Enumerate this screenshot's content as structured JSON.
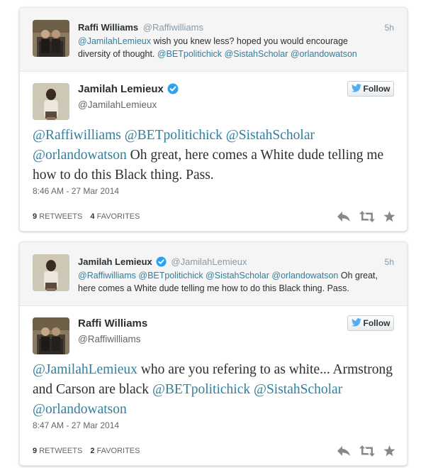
{
  "tweets": [
    {
      "parent": {
        "name": "Raffi Williams",
        "handle": "@Raffiwilliams",
        "time": "5h",
        "text_parts": [
          {
            "t": "@JamilahLemieux",
            "m": true
          },
          {
            "t": " wish you knew less? hoped you would encourage diversity of thought. ",
            "m": false
          },
          {
            "t": "@BETpolitichick",
            "m": true
          },
          {
            "t": " ",
            "m": false
          },
          {
            "t": "@SistahScholar",
            "m": true
          },
          {
            "t": " ",
            "m": false
          },
          {
            "t": "@orlandowatson",
            "m": true
          }
        ]
      },
      "main": {
        "name": "Jamilah Lemieux",
        "handle": "@JamilahLemieux",
        "verified": true,
        "follow_label": "Follow",
        "text_parts": [
          {
            "t": "@Raffiwilliams",
            "m": true
          },
          {
            "t": " ",
            "m": false
          },
          {
            "t": "@BETpolitichick",
            "m": true
          },
          {
            "t": " ",
            "m": false
          },
          {
            "t": "@SistahScholar",
            "m": true
          },
          {
            "t": " ",
            "m": false
          },
          {
            "t": "@orlandowatson",
            "m": true
          },
          {
            "t": " Oh great, here comes a White dude telling me how to do this Black thing. Pass.",
            "m": false
          }
        ],
        "timestamp": "8:46 AM - 27 Mar 2014",
        "retweets": "9",
        "retweets_label": "RETWEETS",
        "favorites": "4",
        "favorites_label": "FAVORITES"
      }
    },
    {
      "parent": {
        "name": "Jamilah Lemieux",
        "handle": "@JamilahLemieux",
        "time": "5h",
        "text_parts": [
          {
            "t": "@Raffiwilliams",
            "m": true
          },
          {
            "t": " ",
            "m": false
          },
          {
            "t": "@BETpolitichick",
            "m": true
          },
          {
            "t": " ",
            "m": false
          },
          {
            "t": "@SistahScholar",
            "m": true
          },
          {
            "t": " ",
            "m": false
          },
          {
            "t": "@orlandowatson",
            "m": true
          },
          {
            "t": " Oh great, here comes a White dude telling me how to do this Black thing. Pass.",
            "m": false
          }
        ]
      },
      "main": {
        "name": "Raffi Williams",
        "handle": "@Raffiwilliams",
        "verified": false,
        "follow_label": "Follow",
        "text_parts": [
          {
            "t": "@JamilahLemieux",
            "m": true
          },
          {
            "t": " who are you refering to as white... Armstrong and Carson are black ",
            "m": false
          },
          {
            "t": "@BETpolitichick",
            "m": true
          },
          {
            "t": " ",
            "m": false
          },
          {
            "t": "@SistahScholar",
            "m": true
          },
          {
            "t": " ",
            "m": false
          },
          {
            "t": "@orlandowatson",
            "m": true
          }
        ],
        "timestamp": "8:47 AM - 27 Mar 2014",
        "retweets": "9",
        "retweets_label": "RETWEETS",
        "favorites": "2",
        "favorites_label": "FAVORITES"
      }
    }
  ],
  "colors": {
    "mention": "#2f7f9f",
    "verified": "#2aa3ef",
    "twitter_bird": "#55acee",
    "action_icon": "#888888"
  },
  "icons": {
    "verified": "verified-badge-icon",
    "follow": "twitter-bird-icon",
    "reply": "reply-icon",
    "retweet": "retweet-icon",
    "favorite": "star-icon"
  }
}
